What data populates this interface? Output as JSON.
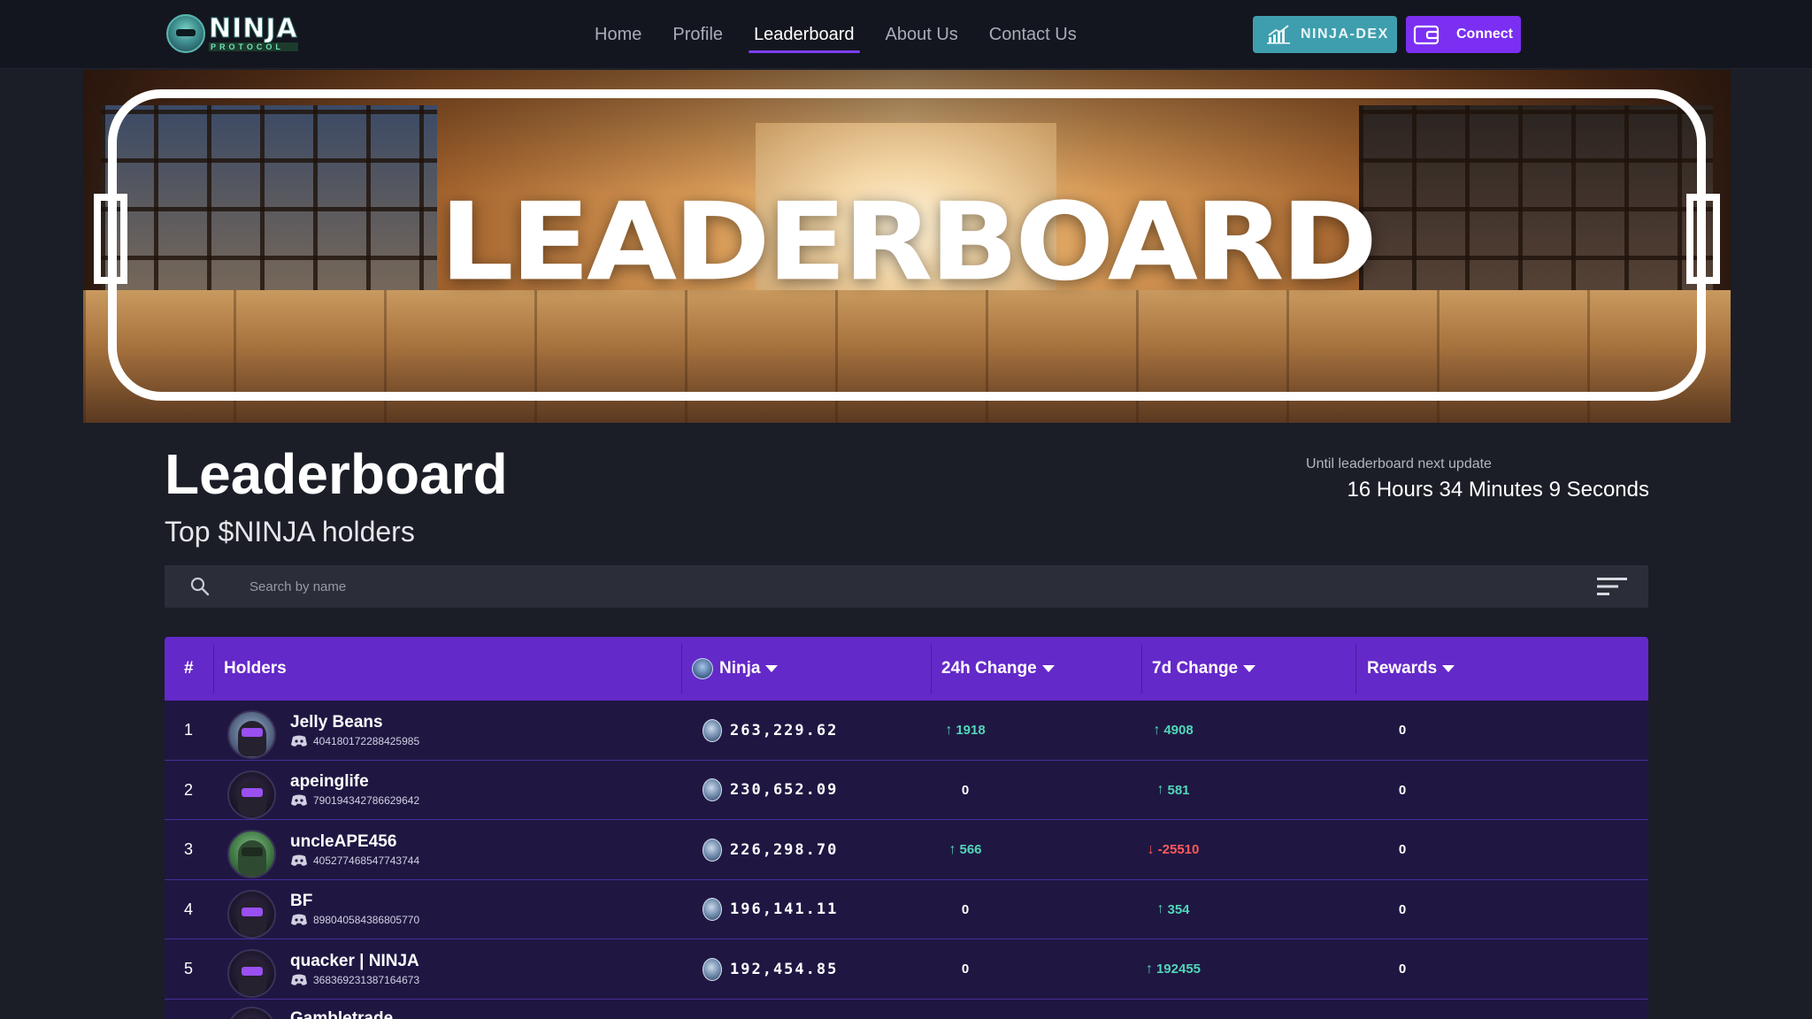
{
  "nav": {
    "logo_word": "NINJA",
    "logo_sub": "PROTOCOL",
    "links": [
      "Home",
      "Profile",
      "Leaderboard",
      "About Us",
      "Contact Us"
    ],
    "active": "Leaderboard",
    "dex_label": "NINJA-DEX",
    "connect_label": "Connect"
  },
  "banner": {
    "title": "LEADERBOARD"
  },
  "header": {
    "title": "Leaderboard",
    "subtitle": "Top $NINJA holders",
    "timer_label": "Until leaderboard next update",
    "timer_value": "16 Hours 34 Minutes 9 Seconds"
  },
  "search": {
    "placeholder": "Search by name"
  },
  "table": {
    "headers": {
      "rank": "#",
      "holders": "Holders",
      "ninja": "Ninja",
      "change_24h": "24h Change",
      "change_7d": "7d Change",
      "rewards": "Rewards"
    },
    "rows": [
      {
        "rank": "1",
        "name": "Jelly Beans",
        "id": "404180172288425985",
        "ninja": "263,229.62",
        "c24": "1918",
        "c24_dir": "up",
        "c7": "4908",
        "c7_dir": "up",
        "rewards": "0"
      },
      {
        "rank": "2",
        "name": "apeinglife",
        "id": "790194342786629642",
        "ninja": "230,652.09",
        "c24": "0",
        "c24_dir": "zero",
        "c7": "581",
        "c7_dir": "up",
        "rewards": "0"
      },
      {
        "rank": "3",
        "name": "uncleAPE456",
        "id": "405277468547743744",
        "ninja": "226,298.70",
        "c24": "566",
        "c24_dir": "up",
        "c7": "-25510",
        "c7_dir": "down",
        "rewards": "0"
      },
      {
        "rank": "4",
        "name": "BF",
        "id": "898040584386805770",
        "ninja": "196,141.11",
        "c24": "0",
        "c24_dir": "zero",
        "c7": "354",
        "c7_dir": "up",
        "rewards": "0"
      },
      {
        "rank": "5",
        "name": "quacker | NINJA",
        "id": "368369231387164673",
        "ninja": "192,454.85",
        "c24": "0",
        "c24_dir": "zero",
        "c7": "192455",
        "c7_dir": "up",
        "rewards": "0"
      },
      {
        "rank": "",
        "name": "Gambletrade",
        "id": "",
        "ninja": "",
        "c24": "",
        "c24_dir": "zero",
        "c7": "",
        "c7_dir": "zero",
        "rewards": ""
      }
    ]
  },
  "colors": {
    "accent": "#7b2ff2",
    "header_row": "#6429c9",
    "dex_button": "#3f9eae",
    "up": "#52d6b7",
    "down": "#ff5a5a"
  }
}
